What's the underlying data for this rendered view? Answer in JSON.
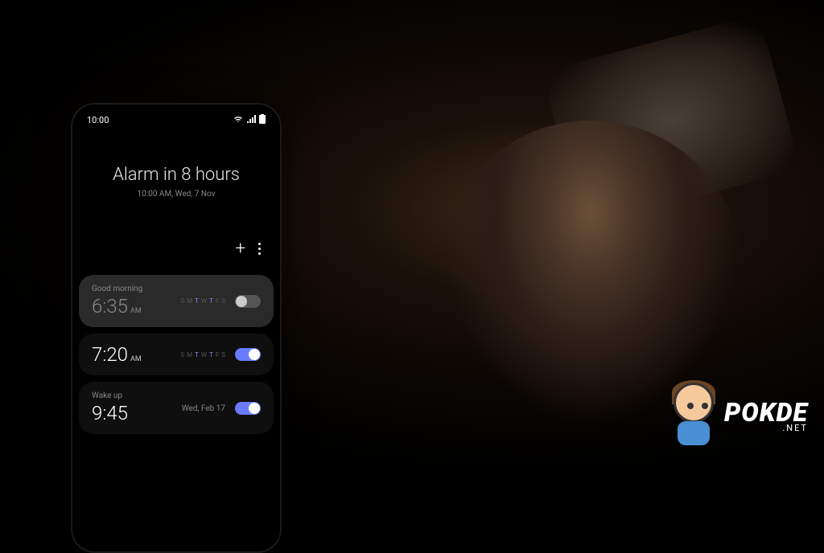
{
  "status_bar": {
    "time": "10:00"
  },
  "header": {
    "title": "Alarm in 8 hours",
    "subtitle": "10:00 AM, Wed, 7 Nov"
  },
  "days_labels": [
    "S",
    "M",
    "T",
    "W",
    "T",
    "F",
    "S"
  ],
  "alarms": [
    {
      "label": "Good morning",
      "time": "6:35",
      "ampm": "AM",
      "date": "",
      "days_active": [
        false,
        false,
        true,
        false,
        true,
        false,
        false
      ],
      "enabled": false
    },
    {
      "label": "",
      "time": "7:20",
      "ampm": "AM",
      "date": "",
      "days_active": [
        false,
        false,
        true,
        false,
        true,
        false,
        false
      ],
      "enabled": true
    },
    {
      "label": "Wake up",
      "time": "9:45",
      "ampm": "",
      "date": "Wed, Feb 17",
      "days_active": [],
      "enabled": true
    }
  ],
  "logo": {
    "text": "POKDE",
    "sub": ".NET"
  },
  "colors": {
    "accent": "#6b7bff",
    "card_bg": "#2a2a2a",
    "card_active_bg": "#0f0f0f"
  }
}
